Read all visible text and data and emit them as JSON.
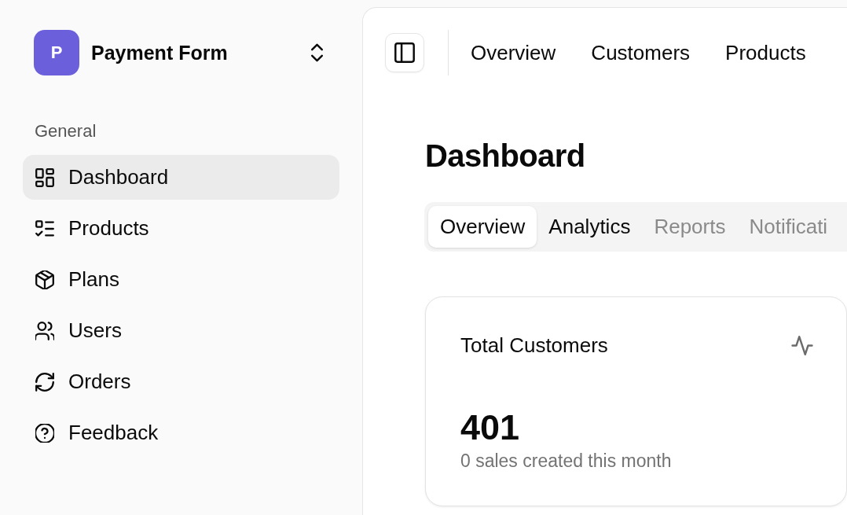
{
  "workspace": {
    "initial": "P",
    "name": "Payment Form"
  },
  "sidebar": {
    "section_label": "General",
    "items": [
      {
        "label": "Dashboard",
        "selected": true
      },
      {
        "label": "Products",
        "selected": false
      },
      {
        "label": "Plans",
        "selected": false
      },
      {
        "label": "Users",
        "selected": false
      },
      {
        "label": "Orders",
        "selected": false
      },
      {
        "label": "Feedback",
        "selected": false
      }
    ]
  },
  "top_nav": {
    "links": [
      "Overview",
      "Customers",
      "Products"
    ]
  },
  "page": {
    "title": "Dashboard"
  },
  "tabs": [
    {
      "label": "Overview",
      "selected": true,
      "disabled": false
    },
    {
      "label": "Analytics",
      "selected": false,
      "disabled": false
    },
    {
      "label": "Reports",
      "selected": false,
      "disabled": true
    },
    {
      "label": "Notificati",
      "selected": false,
      "disabled": true
    }
  ],
  "stat_card": {
    "title": "Total Customers",
    "value": "401",
    "caption": "0 sales created this month"
  }
}
